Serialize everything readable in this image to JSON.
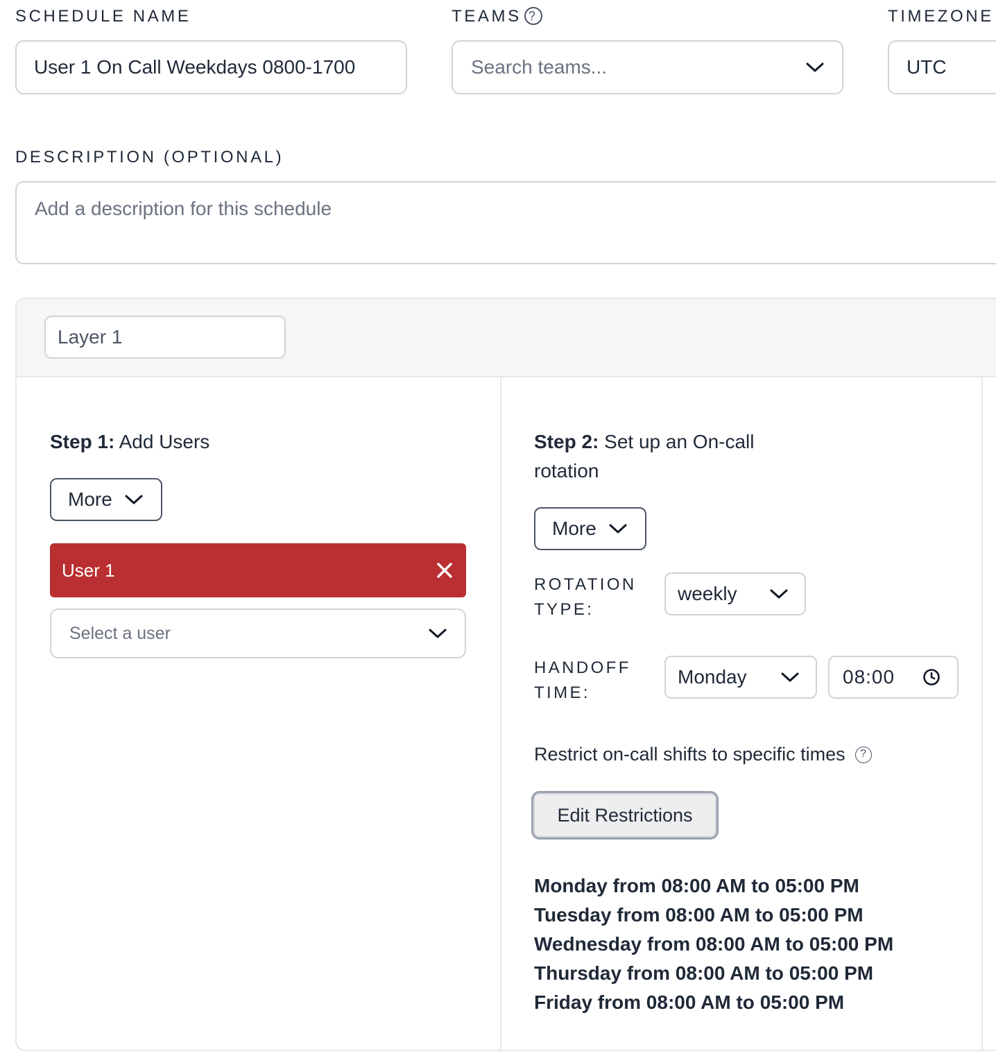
{
  "schedule_name": {
    "label": "SCHEDULE NAME",
    "value": "User 1 On Call Weekdays 0800-1700"
  },
  "teams": {
    "label": "TEAMS",
    "help_glyph": "?",
    "placeholder": "Search teams..."
  },
  "timezone": {
    "label": "TIMEZONE",
    "value": "UTC"
  },
  "description": {
    "label": "DESCRIPTION (OPTIONAL)",
    "placeholder": "Add a description for this schedule"
  },
  "layer": {
    "name": "Layer 1",
    "step1": {
      "title_bold": "Step 1:",
      "title_rest": " Add Users",
      "more_label": "More",
      "users": [
        {
          "name": "User 1"
        }
      ],
      "select_placeholder": "Select a user"
    },
    "step2": {
      "title_bold": "Step 2:",
      "title_rest_line1": " Set up an On-call",
      "title_rest_line2": "rotation",
      "more_label": "More",
      "rotation_type_label_1": "ROTATION",
      "rotation_type_label_2": "TYPE:",
      "rotation_type_value": "weekly",
      "handoff_label_1": "HANDOFF",
      "handoff_label_2": "TIME:",
      "handoff_day": "Monday",
      "handoff_time": "08:00",
      "restrict_label": "Restrict on-call shifts to specific times",
      "restrict_help": "?",
      "edit_button": "Edit Restrictions",
      "restrictions": [
        "Monday from 08:00 AM to 05:00 PM",
        "Tuesday from 08:00 AM to 05:00 PM",
        "Wednesday from 08:00 AM to 05:00 PM",
        "Thursday from 08:00 AM to 05:00 PM",
        "Friday from 08:00 AM to 05:00 PM"
      ]
    }
  },
  "colors": {
    "user_chip": "#ba2f31",
    "border": "#cfd3db",
    "text": "#1f2937",
    "placeholder": "#6b7280"
  },
  "icons": [
    "help-icon",
    "chevron-down-icon",
    "close-icon",
    "clock-icon"
  ]
}
